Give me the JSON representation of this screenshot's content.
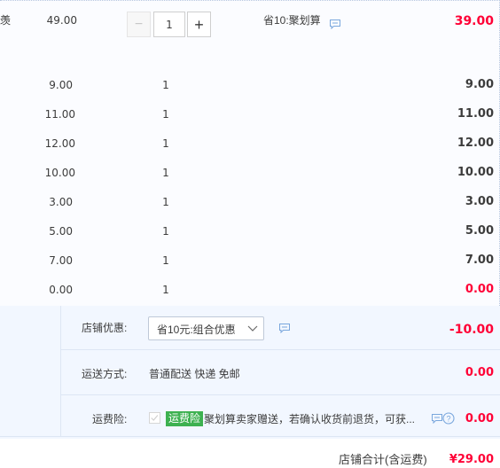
{
  "first_row": {
    "cut_text": "羡",
    "unit_price": "49.00",
    "quantity": "1",
    "minus_symbol": "−",
    "plus_symbol": "+",
    "discount_text": "省10:聚划算",
    "subtotal": "39.00"
  },
  "items": [
    {
      "unit_price": "9.00",
      "quantity": "1",
      "subtotal": "9.00"
    },
    {
      "unit_price": "11.00",
      "quantity": "1",
      "subtotal": "11.00"
    },
    {
      "unit_price": "12.00",
      "quantity": "1",
      "subtotal": "12.00"
    },
    {
      "unit_price": "10.00",
      "quantity": "1",
      "subtotal": "10.00"
    },
    {
      "unit_price": "3.00",
      "quantity": "1",
      "subtotal": "3.00"
    },
    {
      "unit_price": "5.00",
      "quantity": "1",
      "subtotal": "5.00"
    },
    {
      "unit_price": "7.00",
      "quantity": "1",
      "subtotal": "7.00"
    },
    {
      "unit_price": "0.00",
      "quantity": "1",
      "subtotal": "0.00"
    }
  ],
  "shop_discount": {
    "label": "店铺优惠:",
    "selected": "省10元:组合优惠",
    "amount": "-10.00"
  },
  "shipping": {
    "label": "运送方式:",
    "method": "普通配送 快递 免邮",
    "amount": "0.00"
  },
  "insurance": {
    "label": "运费险:",
    "tag": "运费险",
    "text": "聚划算卖家赠送，若确认收货前退货，可获...",
    "amount": "0.00"
  },
  "total": {
    "label": "店铺合计(含运费)",
    "value": "¥29.00"
  },
  "colors": {
    "price_red": "#ff0036",
    "insurance_tag_green": "#3db150",
    "panel_bg": "#f2f7ff"
  },
  "icons": [
    "chat-bubble-icon",
    "chevron-down-icon",
    "help-circle-icon",
    "checkmark-icon"
  ]
}
